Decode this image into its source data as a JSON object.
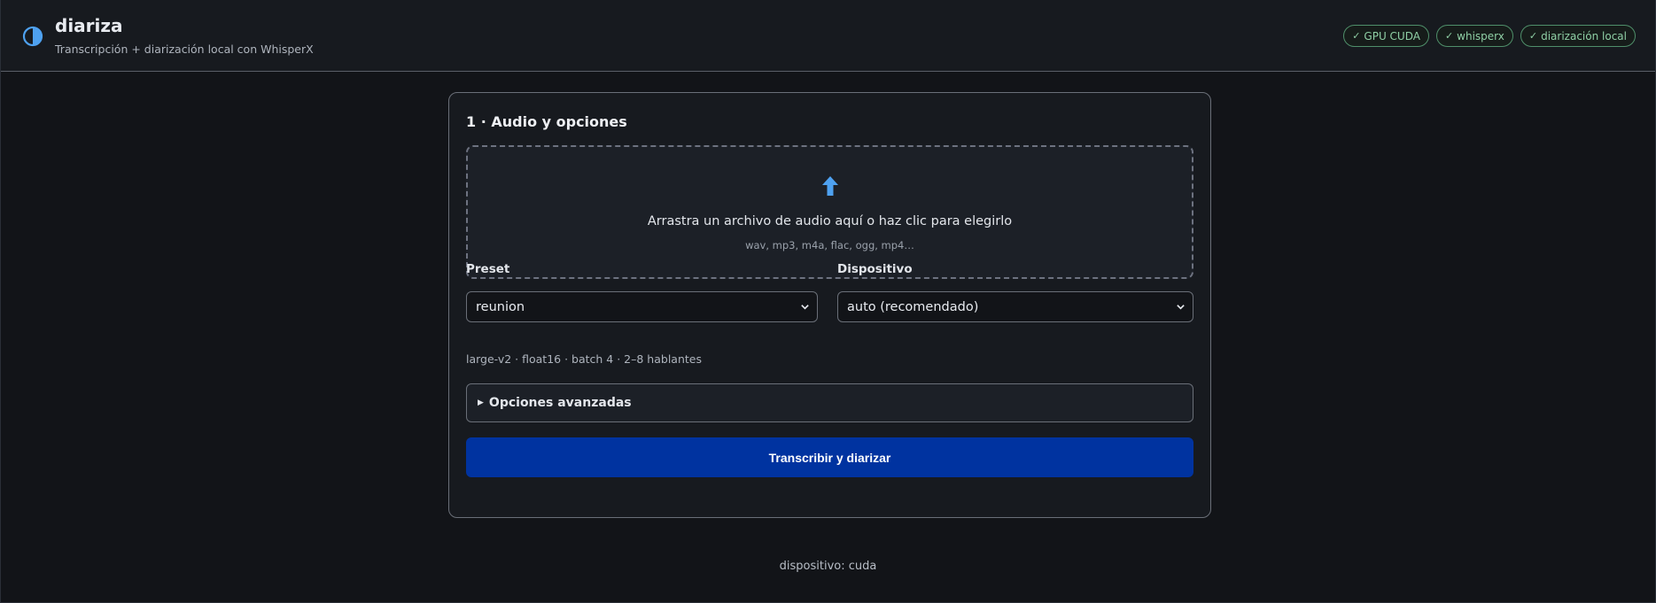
{
  "header": {
    "title": "diariza",
    "subtitle": "Transcripción + diarización local con WhisperX",
    "logo_icon": "half-circle-contrast-icon",
    "badges": [
      {
        "label": "GPU CUDA",
        "icon": "check-icon"
      },
      {
        "label": "whisperx",
        "icon": "check-icon"
      },
      {
        "label": "diarización local",
        "icon": "check-icon"
      }
    ]
  },
  "card": {
    "title": "1 · Audio y opciones",
    "dropzone": {
      "icon": "upload-arrow-icon",
      "text": "Arrastra un archivo de audio aquí o haz clic para elegirlo",
      "hint": "wav, mp3, m4a, flac, ogg, mp4…"
    },
    "preset": {
      "label": "Preset",
      "value": "reunion",
      "info": "large-v2 · float16 · batch 4 · 2–8 hablantes"
    },
    "device": {
      "label": "Dispositivo",
      "value": "auto (recomendado)"
    },
    "advanced_label": "Opciones avanzadas",
    "submit_label": "Transcribir y diarizar"
  },
  "footer": {
    "status": "dispositivo: cuda"
  },
  "colors": {
    "background": "#121418",
    "accent_blue": "#0033a0",
    "icon_blue": "#4ea1f0",
    "badge_green": "#8fcfa5"
  }
}
